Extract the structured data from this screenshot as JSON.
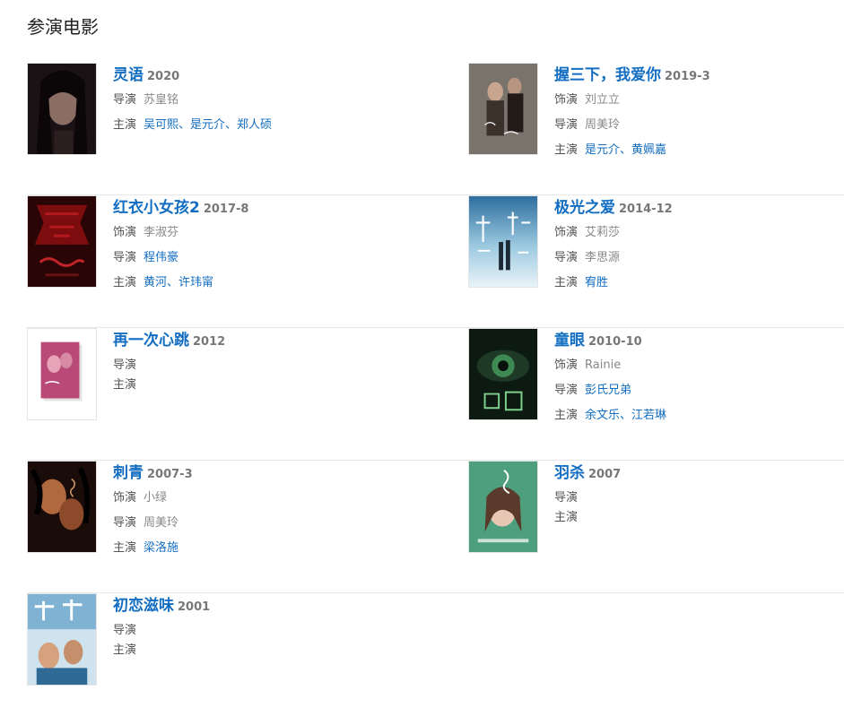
{
  "section": {
    "title": "参演电影"
  },
  "labels": {
    "role": "饰演",
    "director": "导演",
    "cast": "主演"
  },
  "movies": [
    {
      "title": "灵语",
      "year": "2020",
      "director": "苏皇铭",
      "cast": "吴可熙、是元介、郑人硕"
    },
    {
      "title": "握三下，我爱你",
      "year": "2019-3",
      "role": "刘立立",
      "director": "周美玲",
      "cast": "是元介、黄姵嘉"
    },
    {
      "title": "红衣小女孩2",
      "year": "2017-8",
      "role": "李淑芬",
      "director": "程伟豪",
      "cast": "黄河、许玮甯"
    },
    {
      "title": "极光之爱",
      "year": "2014-12",
      "role": "艾莉莎",
      "director": "李思源",
      "cast": "宥胜"
    },
    {
      "title": "再一次心跳",
      "year": "2012"
    },
    {
      "title": "童眼",
      "year": "2010-10",
      "role": "Rainie",
      "director": "彭氏兄弟",
      "cast": "余文乐、江若琳"
    },
    {
      "title": "刺青",
      "year": "2007-3",
      "role": "小绿",
      "director": "周美玲",
      "cast": "梁洛施"
    },
    {
      "title": "羽杀",
      "year": "2007"
    },
    {
      "title": "初恋滋味",
      "year": "2001"
    }
  ],
  "colors": {
    "link": "#136ec2",
    "label": "#555555",
    "muted": "#888888",
    "year": "#777777"
  },
  "icons": [
    "poster-lingyu-icon",
    "poster-woshanxia-icon",
    "poster-hongyi-icon",
    "poster-jiguang-icon",
    "poster-zaiyici-icon",
    "poster-tongyan-icon",
    "poster-ciqing-icon",
    "poster-yusha-icon",
    "poster-chulian-icon"
  ]
}
